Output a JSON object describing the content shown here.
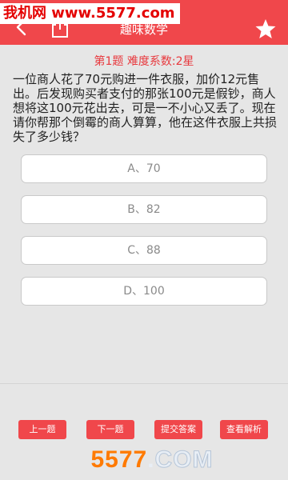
{
  "header": {
    "title": "趣味数学"
  },
  "watermark_top": "我机网 www.5577.com",
  "question": {
    "number_label": "第1题",
    "difficulty_label": "难度系数:2星",
    "text": "一位商人花了70元购进一件衣服，加价12元售出。后发现购买者支付的那张100元是假钞，商人想将这100元花出去，可是一不小心又丢了。现在请你帮那个倒霉的商人算算，他在这件衣服上共损失了多少钱？"
  },
  "options": [
    {
      "label": "A、70"
    },
    {
      "label": "B、82"
    },
    {
      "label": "C、88"
    },
    {
      "label": "D、100"
    }
  ],
  "buttons": {
    "prev": "上一题",
    "next": "下一题",
    "submit": "提交答案",
    "analysis": "查看解析"
  },
  "watermark_bottom": {
    "num": "5577",
    "dot": ".",
    "com": "COM"
  },
  "colors": {
    "accent": "#f0474b",
    "question_meta": "#e8383d",
    "watermark_orange": "#ff7a00"
  },
  "icons": {
    "back": "chevron-left-icon",
    "share": "share-icon",
    "favorite": "star-icon"
  }
}
